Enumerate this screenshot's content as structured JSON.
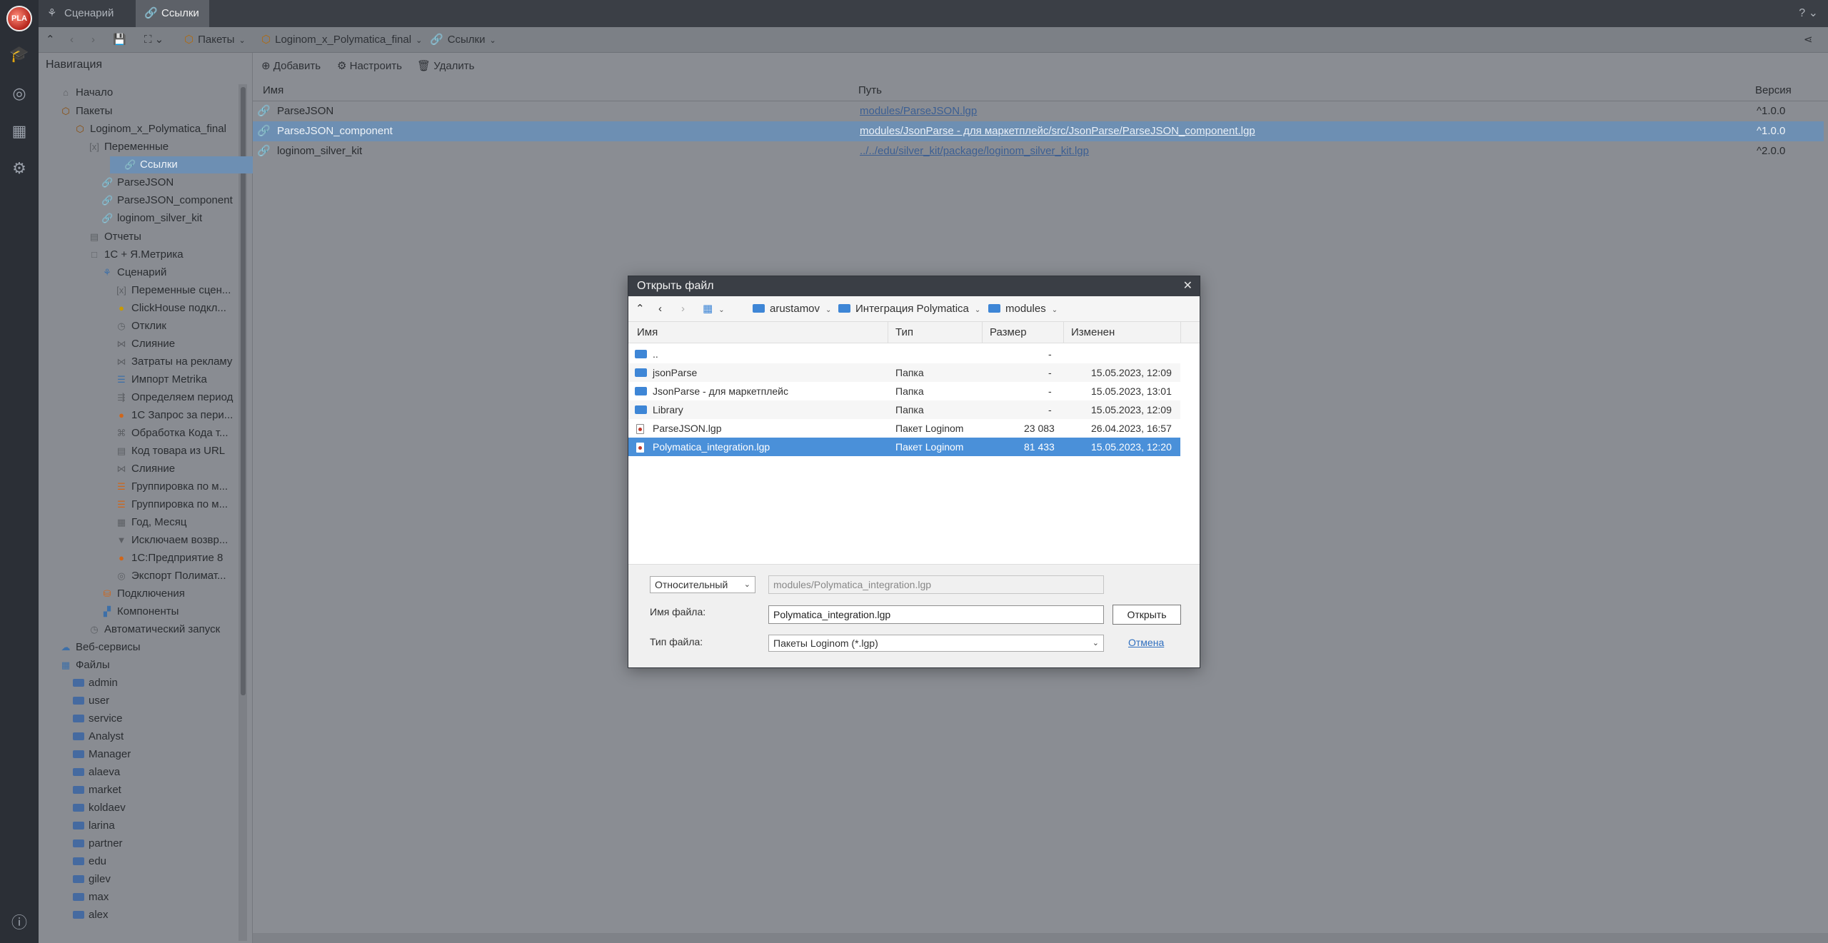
{
  "rail": {
    "logo_text": "PLA"
  },
  "tabs": [
    {
      "label": "Сценарий"
    },
    {
      "label": "Ссылки"
    }
  ],
  "help_icon": "?",
  "toolbar": {
    "crumbs": [
      {
        "label": "Пакеты"
      },
      {
        "label": "Loginom_x_Polymatica_final"
      },
      {
        "label": "Ссылки"
      }
    ]
  },
  "nav": {
    "title": "Навигация",
    "items": [
      {
        "label": "Начало"
      },
      {
        "label": "Пакеты"
      },
      {
        "label": "Loginom_x_Polymatica_final"
      },
      {
        "label": "Переменные"
      },
      {
        "label": "Ссылки"
      },
      {
        "label": "ParseJSON"
      },
      {
        "label": "ParseJSON_component"
      },
      {
        "label": "loginom_silver_kit"
      },
      {
        "label": "Отчеты"
      },
      {
        "label": "1С + Я.Метрика"
      },
      {
        "label": "Сценарий"
      },
      {
        "label": "Переменные сцен..."
      },
      {
        "label": "ClickHouse подкл..."
      },
      {
        "label": "Отклик"
      },
      {
        "label": "Слияние"
      },
      {
        "label": "Затраты на рекламу"
      },
      {
        "label": "Импорт Metrika"
      },
      {
        "label": "Определяем период"
      },
      {
        "label": "1С Запрос за пери..."
      },
      {
        "label": "Обработка Кода т..."
      },
      {
        "label": "Код товара из URL"
      },
      {
        "label": "Слияние"
      },
      {
        "label": "Группировка по м..."
      },
      {
        "label": "Группировка по м..."
      },
      {
        "label": "Год, Месяц"
      },
      {
        "label": "Исключаем возвр..."
      },
      {
        "label": "1С:Предприятие 8"
      },
      {
        "label": "Экспорт Полимат..."
      },
      {
        "label": "Подключения"
      },
      {
        "label": "Компоненты"
      },
      {
        "label": "Автоматический запуск"
      },
      {
        "label": "Веб-сервисы"
      },
      {
        "label": "Файлы"
      },
      {
        "label": "admin"
      },
      {
        "label": "user"
      },
      {
        "label": "service"
      },
      {
        "label": "Analyst"
      },
      {
        "label": "Manager"
      },
      {
        "label": "alaeva"
      },
      {
        "label": "market"
      },
      {
        "label": "koldaev"
      },
      {
        "label": "larina"
      },
      {
        "label": "partner"
      },
      {
        "label": "edu"
      },
      {
        "label": "gilev"
      },
      {
        "label": "max"
      },
      {
        "label": "alex"
      }
    ]
  },
  "main": {
    "actions": {
      "add": "Добавить",
      "configure": "Настроить",
      "delete": "Удалить"
    },
    "columns": {
      "name": "Имя",
      "path": "Путь",
      "version": "Версия"
    },
    "rows": [
      {
        "name": "ParseJSON",
        "path": "modules/ParseJSON.lgp",
        "version": "^1.0.0"
      },
      {
        "name": "ParseJSON_component",
        "path": "modules/JsonParse - для маркетплейс/src/JsonParse/ParseJSON_component.lgp",
        "version": "^1.0.0"
      },
      {
        "name": "loginom_silver_kit",
        "path": "../../edu/silver_kit/package/loginom_silver_kit.lgp",
        "version": "^2.0.0"
      }
    ]
  },
  "dialog": {
    "title": "Открыть файл",
    "close": "✕",
    "path": [
      {
        "label": "arustamov"
      },
      {
        "label": "Интеграция Polymatica"
      },
      {
        "label": "modules"
      }
    ],
    "columns": {
      "name": "Имя",
      "type": "Тип",
      "size": "Размер",
      "modified": "Изменен"
    },
    "files": [
      {
        "name": "..",
        "type": "",
        "size": "-",
        "modified": ""
      },
      {
        "name": "jsonParse",
        "type": "Папка",
        "size": "-",
        "modified": "15.05.2023, 12:09"
      },
      {
        "name": "JsonParse - для маркетплейс",
        "type": "Папка",
        "size": "-",
        "modified": "15.05.2023, 13:01"
      },
      {
        "name": "Library",
        "type": "Папка",
        "size": "-",
        "modified": "15.05.2023, 12:09"
      },
      {
        "name": "ParseJSON.lgp",
        "type": "Пакет Loginom",
        "size": "23 083",
        "modified": "26.04.2023, 16:57"
      },
      {
        "name": "Polymatica_integration.lgp",
        "type": "Пакет Loginom",
        "size": "81 433",
        "modified": "15.05.2023, 12:20"
      }
    ],
    "path_mode": "Относительный",
    "path_value": "modules/Polymatica_integration.lgp",
    "filename_label": "Имя файла:",
    "filename_value": "Polymatica_integration.lgp",
    "filetype_label": "Тип файла:",
    "filetype_value": "Пакеты Loginom (*.lgp)",
    "open_button": "Открыть",
    "cancel_link": "Отмена"
  },
  "colors": {
    "accent": "#4a90d9",
    "selection": "#6d8fb3",
    "package_icon": "#b06a10"
  }
}
